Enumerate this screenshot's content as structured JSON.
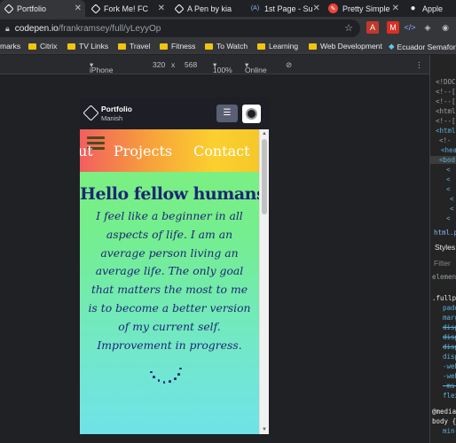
{
  "browser": {
    "tabs": [
      {
        "label": "Portfolio",
        "active": true,
        "favicon": "codepen-icon",
        "favicon_color": "#ffffff"
      },
      {
        "label": "Fork Me! FC",
        "active": false,
        "favicon": "codepen-icon",
        "favicon_color": "#ffffff"
      },
      {
        "label": "A Pen by kia",
        "active": false,
        "favicon": "codepen-icon",
        "favicon_color": "#ffffff"
      },
      {
        "label": "1st Page - Su",
        "active": false,
        "favicon": "a11y-icon",
        "favicon_color": "#8ab4f8"
      },
      {
        "label": "Pretty Simple",
        "active": false,
        "favicon": "pen-icon",
        "favicon_color": "#e8453c"
      },
      {
        "label": "Apple",
        "active": false,
        "favicon": "apple-icon",
        "favicon_color": "#e8eaed"
      }
    ],
    "url_host": "codepen.io",
    "url_path": "/frankramsey/full/yLeyyOp",
    "bookmarks": [
      {
        "label": "marks",
        "type": "text"
      },
      {
        "label": "Citrix",
        "type": "folder"
      },
      {
        "label": "TV Links",
        "type": "folder"
      },
      {
        "label": "Travel",
        "type": "folder"
      },
      {
        "label": "Fitness",
        "type": "folder"
      },
      {
        "label": "To Watch",
        "type": "folder"
      },
      {
        "label": "Learning",
        "type": "folder"
      },
      {
        "label": "Web Development",
        "type": "folder"
      },
      {
        "label": "Ecuador Semafor",
        "type": "link"
      }
    ]
  },
  "device_toolbar": {
    "device": "iPhone 5/SE",
    "width": "320",
    "times": "x",
    "height": "568",
    "zoom": "100%",
    "network": "Online"
  },
  "devtools": {
    "lines": [
      "<!DOC",
      "<!--[",
      "<!--[",
      "<html",
      "<!--[",
      "<html",
      "<!-",
      "<hea",
      "<bod",
      "<",
      "<",
      "<",
      "<",
      "<",
      "<"
    ],
    "tab_html": "html.pc",
    "styles_label": "Styles",
    "filter_label": "Filter",
    "element_label": "element",
    "rule_selector": ".fullp",
    "props": [
      "padd",
      "marg",
      "disp",
      "disp",
      "disp",
      "disp",
      "-web",
      "-web",
      "-ms-",
      "flex"
    ],
    "media_label": "@media",
    "body_label": "body {",
    "min_label": "min-"
  },
  "codepen": {
    "title": "Portfolio",
    "author": "Manish",
    "view_button_icon": "layout-toggle-icon"
  },
  "pen": {
    "nav_items": [
      "ut",
      "Projects",
      "Contact"
    ],
    "heading": "Hello fellow humans",
    "paragraph": "I feel like a beginner in all aspects of life. I am an average person living an average life. The only goal that matters the most to me is to become a better version of my current self. Improvement in progress."
  },
  "colors": {
    "nav_gradient_start": "#f25f5f",
    "nav_gradient_end": "#f6c72b",
    "body_gradient_top": "#7ef07a",
    "body_gradient_bottom": "#6fe2e8",
    "text_navy": "#1e2675"
  }
}
